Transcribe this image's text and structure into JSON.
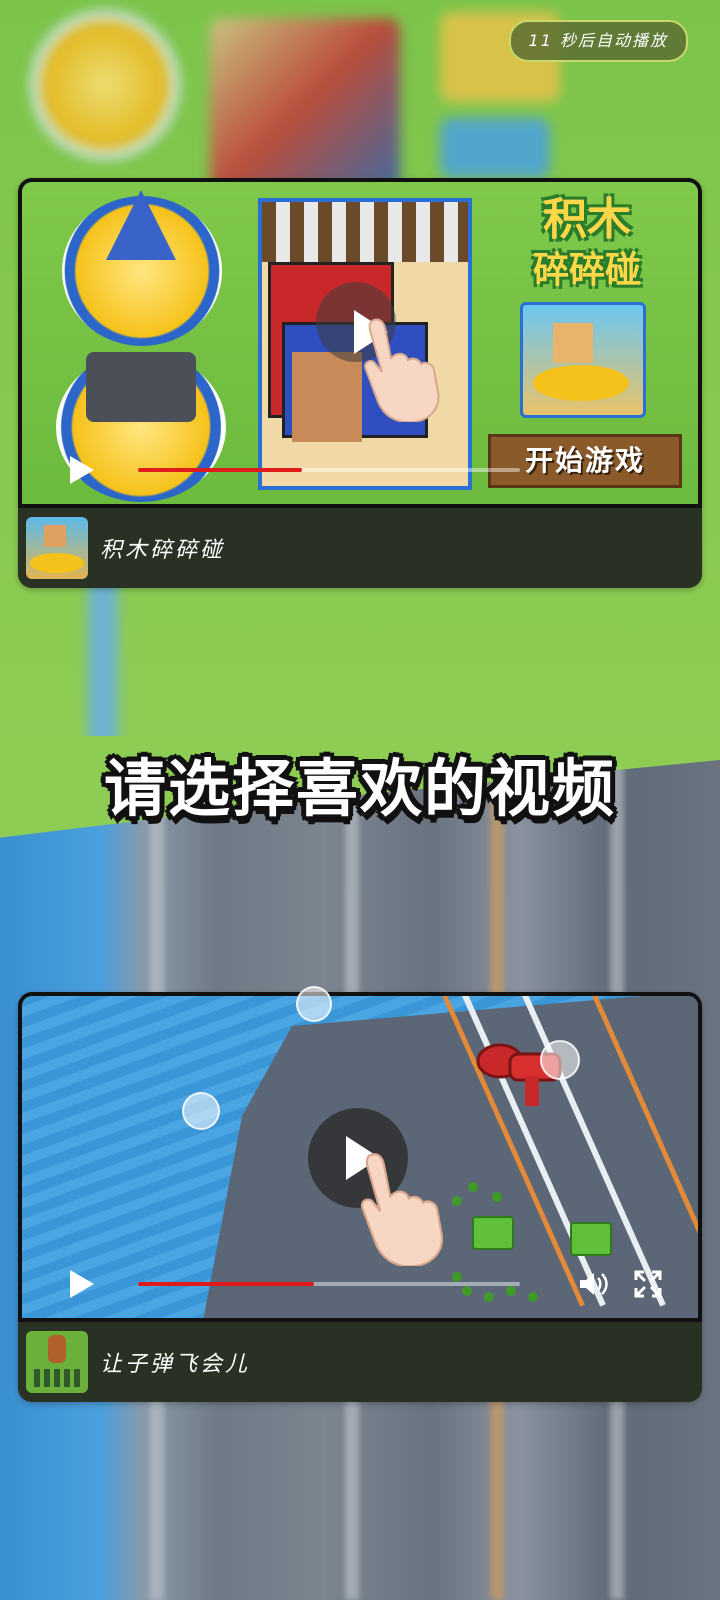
{
  "countdown": {
    "text": "11 秒后自动播放"
  },
  "heading": {
    "text": "请选择喜欢的视频"
  },
  "videos": [
    {
      "title": "积木碎碎碰",
      "art_logo": "积木\n碎碎碰",
      "art_button": "开始游戏",
      "progress": 0.43,
      "accent": "#e01b1b"
    },
    {
      "title": "让子弹飞会儿",
      "progress": 0.46,
      "accent": "#e01b1b"
    }
  ],
  "icons": {
    "play": "play-icon",
    "volume": "volume-icon",
    "fullscreen": "fullscreen-icon",
    "big_play": "play-button-icon",
    "hand": "tap-hand-icon"
  },
  "colors": {
    "background_green": "#86c94f",
    "progress_red": "#e01b1b",
    "info_bar": "#283024"
  }
}
